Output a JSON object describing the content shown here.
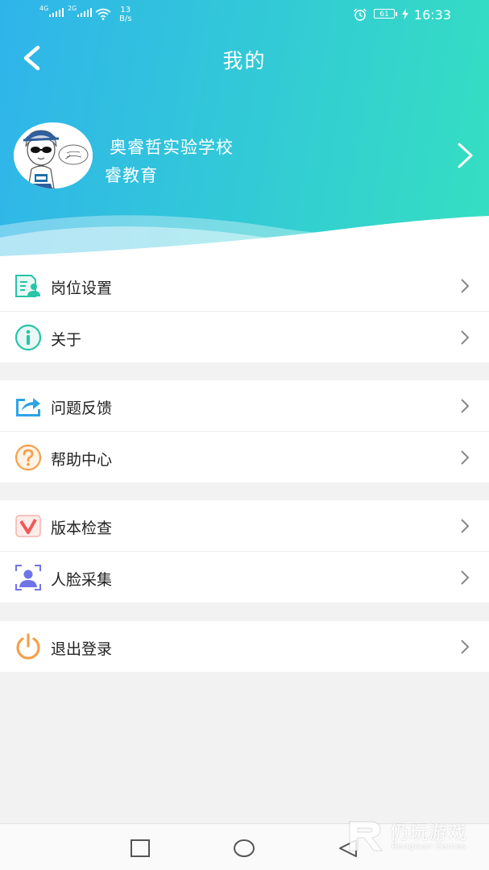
{
  "status_bar": {
    "sim1_tag": "4G",
    "sim2_tag": "2G",
    "net_speed_value": "13",
    "net_speed_unit": "B/s",
    "battery": "61",
    "time": "16:33"
  },
  "header": {
    "title": "我的"
  },
  "profile": {
    "school": "奥睿哲实验学校",
    "org": "睿教育"
  },
  "menu_groups": [
    {
      "items": [
        {
          "label": "岗位设置",
          "icon": "job-settings-icon",
          "color": "#27c4a8"
        },
        {
          "label": "关于",
          "icon": "info-icon",
          "color": "#27c4a8"
        }
      ]
    },
    {
      "items": [
        {
          "label": "问题反馈",
          "icon": "feedback-share-icon",
          "color": "#2fa3e6"
        },
        {
          "label": "帮助中心",
          "icon": "help-icon",
          "color": "#f5a04a"
        }
      ]
    },
    {
      "items": [
        {
          "label": "版本检查",
          "icon": "version-check-icon",
          "color": "#ef5a56"
        },
        {
          "label": "人脸采集",
          "icon": "face-capture-icon",
          "color": "#6f74e6"
        }
      ]
    },
    {
      "items": [
        {
          "label": "退出登录",
          "icon": "power-icon",
          "color": "#f5a04a"
        }
      ]
    }
  ],
  "watermark": {
    "title": "仍玩游戏",
    "subtitle": "Rengwan Games"
  },
  "colors": {
    "gradient_start": "#2fb4ea",
    "gradient_end": "#35dfc1",
    "background": "#f2f2f2"
  }
}
